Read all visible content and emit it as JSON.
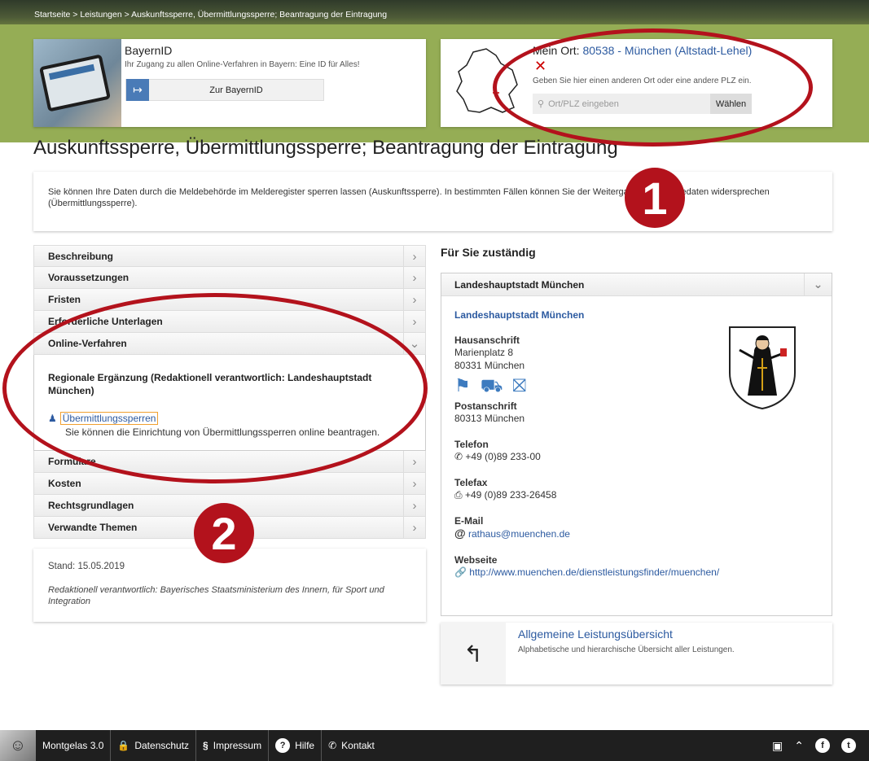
{
  "breadcrumb": "Startseite > Leistungen > Auskunftssperre, Übermittlungssperre; Beantragung der Eintragung",
  "bayernid": {
    "title": "BayernID",
    "subtitle": "Ihr Zugang zu allen Online-Verfahren in Bayern: Eine ID für Alles!",
    "button_label": "Zur BayernID",
    "button_icon": "login-arrow-icon"
  },
  "ort": {
    "prefix": "Mein Ort: ",
    "location": "80538 - München (Altstadt-Lehel)",
    "remove_icon": "close-icon",
    "hint": "Geben Sie hier einen anderen Ort oder eine andere PLZ ein.",
    "placeholder": "Ort/PLZ eingeben",
    "choose_label": "Wählen"
  },
  "page_title": "Auskunftssperre, Übermittlungssperre; Beantragung der Eintragung",
  "intro": "Sie können Ihre Daten durch die Meldebehörde im Melderegister sperren lassen (Auskunftssperre). In bestimmten Fällen können Sie der Weitergabe Ihrer Meldedaten widersprechen (Übermittlungssperre).",
  "accordion": {
    "before": [
      "Beschreibung",
      "Voraussetzungen",
      "Fristen",
      "Erforderliche Unterlagen",
      "Online-Verfahren"
    ],
    "open_heading": "Regionale Ergänzung (Redaktionell verantwortlich: Landeshauptstadt München)",
    "open_link": "Übermittlungssperren",
    "open_desc": "Sie können die Einrichtung von Übermittlungssperren online beantragen.",
    "after": [
      "Formulare",
      "Kosten",
      "Rechtsgrundlagen",
      "Verwandte Themen"
    ]
  },
  "stand": {
    "date": "Stand: 15.05.2019",
    "responsible": "Redaktionell verantwortlich: Bayerisches Staatsministerium des Innern, für Sport und Integration"
  },
  "zustaendig": {
    "heading": "Für Sie zuständig",
    "panel_title": "Landeshauptstadt München",
    "authority": "Landeshauptstadt München",
    "hausanschrift_label": "Hausanschrift",
    "hausanschrift_street": "Marienplatz 8",
    "hausanschrift_city": "80331 München",
    "postanschrift_label": "Postanschrift",
    "postanschrift_city": "80313 München",
    "telefon_label": "Telefon",
    "telefon": "+49 (0)89 233-00",
    "telefax_label": "Telefax",
    "telefax": "+49 (0)89 233-26458",
    "email_label": "E-Mail",
    "email": "rathaus@muenchen.de",
    "webseite_label": "Webseite",
    "webseite": "http://www.muenchen.de/dienstleistungsfinder/muenchen/"
  },
  "leistung": {
    "title": "Allgemeine Leistungsübersicht",
    "subtitle": "Alphabetische und hierarchische Übersicht aller Leistungen."
  },
  "footer": {
    "brand": "Montgelas 3.0",
    "items": [
      "Datenschutz",
      "Impressum",
      "Hilfe",
      "Kontakt"
    ]
  },
  "annotations": [
    "1",
    "2"
  ],
  "colors": {
    "accent": "#2c5aa0",
    "annotation": "#b3121c",
    "grass": "#95ad55"
  }
}
